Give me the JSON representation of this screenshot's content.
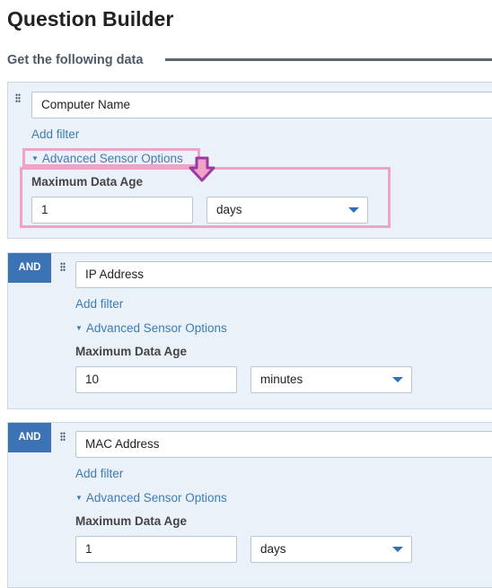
{
  "page": {
    "title": "Question Builder"
  },
  "section": {
    "title": "Get the following data"
  },
  "sensors": [
    {
      "name": "Computer Name",
      "add_filter": "Add filter",
      "advanced": "Advanced Sensor Options",
      "max_age_label": "Maximum Data Age",
      "max_age_value": "1",
      "max_age_unit": "days"
    },
    {
      "connector": "AND",
      "name": "IP Address",
      "add_filter": "Add filter",
      "advanced": "Advanced Sensor Options",
      "max_age_label": "Maximum Data Age",
      "max_age_value": "10",
      "max_age_unit": "minutes"
    },
    {
      "connector": "AND",
      "name": "MAC Address",
      "add_filter": "Add filter",
      "advanced": "Advanced Sensor Options",
      "max_age_label": "Maximum Data Age",
      "max_age_value": "1",
      "max_age_unit": "days"
    }
  ],
  "annotation": {
    "highlight_color": "#f2a2c7",
    "arrow_color": "#9b3aa3",
    "arrow_icon": "arrow-down-icon"
  },
  "colors": {
    "accent": "#3b73b5",
    "link": "#3f7cb2",
    "card_bg": "#eaf1f9"
  }
}
